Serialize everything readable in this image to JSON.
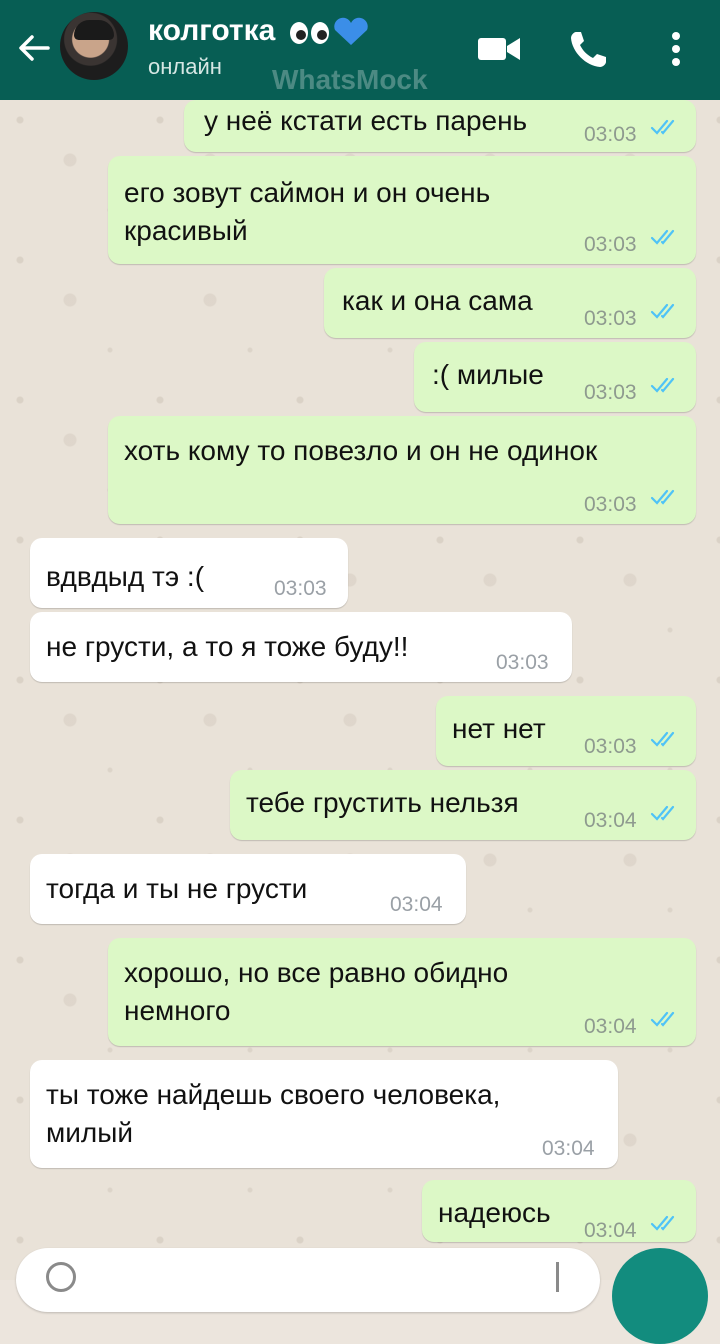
{
  "header": {
    "contact_name": "колготка",
    "status": "онлайн",
    "watermark": "WhatsMock",
    "accent_color": "#075e54"
  },
  "messages": [
    {
      "dir": "out",
      "text": [
        "у неё кстати есть парень"
      ],
      "time": "03:03"
    },
    {
      "dir": "out",
      "text": [
        "его зовут саймон и он очень",
        "красивый"
      ],
      "time": "03:03"
    },
    {
      "dir": "out",
      "text": [
        "как и она сама"
      ],
      "time": "03:03"
    },
    {
      "dir": "out",
      "text": [
        ":( милые"
      ],
      "time": "03:03"
    },
    {
      "dir": "out",
      "text": [
        "хоть кому то повезло и он не одинок"
      ],
      "time": "03:03"
    },
    {
      "dir": "in",
      "text": [
        "вдвдыд тэ :("
      ],
      "time": "03:03"
    },
    {
      "dir": "in",
      "text": [
        "не грусти, а то я тоже буду!!"
      ],
      "time": "03:03"
    },
    {
      "dir": "out",
      "text": [
        "нет нет"
      ],
      "time": "03:03"
    },
    {
      "dir": "out",
      "text": [
        "тебе грустить нельзя"
      ],
      "time": "03:04"
    },
    {
      "dir": "in",
      "text": [
        "тогда и ты не грусти"
      ],
      "time": "03:04"
    },
    {
      "dir": "out",
      "text": [
        "хорошо, но все равно обидно",
        "немного"
      ],
      "time": "03:04"
    },
    {
      "dir": "in",
      "text": [
        "ты тоже найдешь своего человека,",
        "милый"
      ],
      "time": "03:04"
    },
    {
      "dir": "out",
      "text": [
        "надеюсь"
      ],
      "time": "03:04"
    }
  ],
  "icons": {
    "back": "back-arrow-icon",
    "video": "video-call-icon",
    "call": "phone-icon",
    "menu": "more-vert-icon",
    "read_receipt": "double-check-icon"
  },
  "colors": {
    "outgoing_bubble": "#dcf8c6",
    "incoming_bubble": "#ffffff",
    "read_tick": "#4fc3f7"
  }
}
